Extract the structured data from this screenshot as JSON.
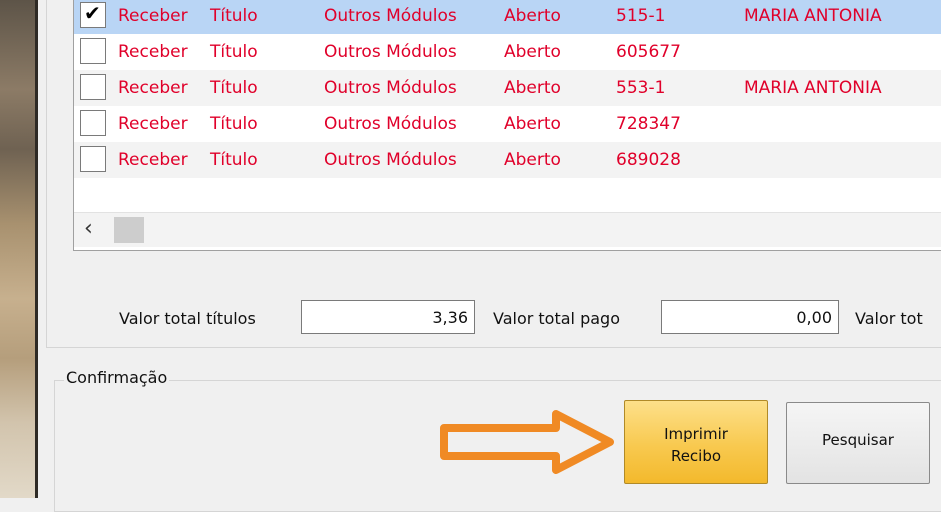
{
  "grid": {
    "rows": [
      {
        "checked": true,
        "col1": "Receber",
        "col2": "Título",
        "col3": "Outros Módulos",
        "col4": "Aberto",
        "col5": "515-1",
        "col6": "MARIA ANTONIA"
      },
      {
        "checked": false,
        "col1": "Receber",
        "col2": "Título",
        "col3": "Outros Módulos",
        "col4": "Aberto",
        "col5": "605677",
        "col6": ""
      },
      {
        "checked": false,
        "col1": "Receber",
        "col2": "Título",
        "col3": "Outros Módulos",
        "col4": "Aberto",
        "col5": "553-1",
        "col6": "MARIA ANTONIA"
      },
      {
        "checked": false,
        "col1": "Receber",
        "col2": "Título",
        "col3": "Outros Módulos",
        "col4": "Aberto",
        "col5": "728347",
        "col6": ""
      },
      {
        "checked": false,
        "col1": "Receber",
        "col2": "Título",
        "col3": "Outros Módulos",
        "col4": "Aberto",
        "col5": "689028",
        "col6": ""
      }
    ],
    "scroll_left_icon": "chevron-left-icon",
    "text_color": "#e0002a",
    "selected_row_color": "#b9d5f5"
  },
  "totals": {
    "total_titles_label": "Valor total títulos",
    "total_titles_value": "3,36",
    "total_paid_label": "Valor total pago",
    "total_paid_value": "0,00",
    "total_third_label": "Valor tot"
  },
  "confirmation": {
    "legend": "Confirmação",
    "print_button_line1": "Imprimir",
    "print_button_line2": "Recibo",
    "search_button": "Pesquisar",
    "annotation_arrow_color": "#f08a24"
  }
}
